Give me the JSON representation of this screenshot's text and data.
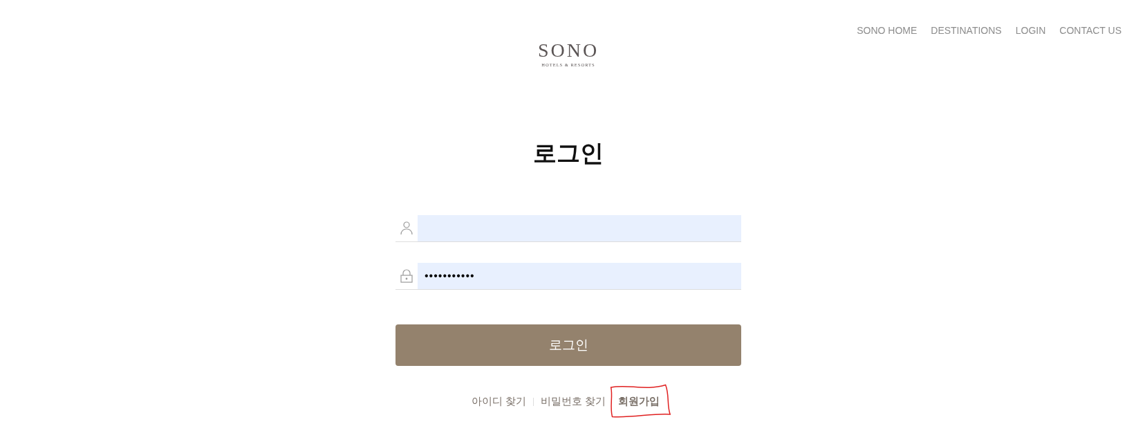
{
  "nav": [
    {
      "label": "SONO HOME"
    },
    {
      "label": "DESTINATIONS"
    },
    {
      "label": "LOGIN"
    },
    {
      "label": "CONTACT US"
    }
  ],
  "logo": {
    "name": "SONO",
    "tagline": "HOTELS & RESORTS"
  },
  "title": "로그인",
  "fields": [
    {
      "kind": "user"
    },
    {
      "kind": "password",
      "value": "•••••••••••"
    }
  ],
  "submit": "로그인",
  "links": [
    {
      "label": "아이디 찾기",
      "highlighted": false
    },
    {
      "label": "비밀번호 찾기",
      "highlighted": false
    },
    {
      "label": "회원가입",
      "highlighted": true
    }
  ]
}
